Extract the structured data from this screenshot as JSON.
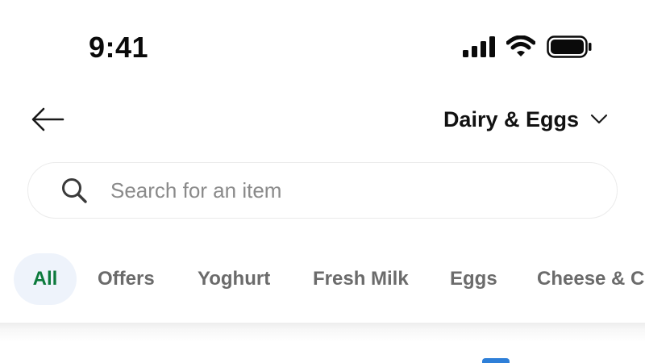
{
  "status_bar": {
    "time": "9:41",
    "icons": [
      "cellular-signal-icon",
      "wifi-icon",
      "battery-icon"
    ]
  },
  "header": {
    "back_icon": "arrow-left-icon",
    "category_title": "Dairy & Eggs",
    "dropdown_icon": "chevron-down-icon"
  },
  "search": {
    "icon": "search-icon",
    "placeholder": "Search for an item",
    "value": ""
  },
  "filters": {
    "items": [
      {
        "label": "All",
        "active": true
      },
      {
        "label": "Offers",
        "active": false
      },
      {
        "label": "Yoghurt",
        "active": false
      },
      {
        "label": "Fresh Milk",
        "active": false
      },
      {
        "label": "Eggs",
        "active": false
      },
      {
        "label": "Cheese & C",
        "active": false
      }
    ]
  },
  "colors": {
    "active_chip_text": "#0c7a3c",
    "active_chip_bg": "#eef3fb",
    "inactive_chip_text": "#6b6b6b",
    "placeholder_text": "#8a8a8a"
  }
}
